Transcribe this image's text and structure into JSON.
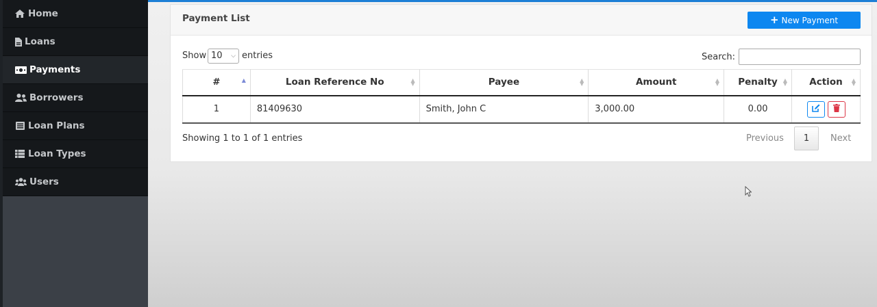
{
  "sidebar": {
    "items": [
      {
        "label": "Home",
        "icon": "home-icon"
      },
      {
        "label": "Loans",
        "icon": "file-icon"
      },
      {
        "label": "Payments",
        "icon": "money-bill-icon",
        "active": true
      },
      {
        "label": "Borrowers",
        "icon": "user-friends-icon"
      },
      {
        "label": "Loan Plans",
        "icon": "list-alt-icon"
      },
      {
        "label": "Loan Types",
        "icon": "th-list-icon"
      },
      {
        "label": "Users",
        "icon": "users-icon"
      }
    ]
  },
  "card": {
    "title": "Payment List",
    "new_button": "New Payment"
  },
  "controls": {
    "show_label": "Show",
    "page_length": "10",
    "entries_label": "entries",
    "search_label": "Search:",
    "search_value": ""
  },
  "table": {
    "columns": [
      "#",
      "Loan Reference No",
      "Payee",
      "Amount",
      "Penalty",
      "Action"
    ],
    "rows": [
      {
        "num": "1",
        "ref": "81409630",
        "payee": "Smith, John C",
        "amount": "3,000.00",
        "penalty": "0.00"
      }
    ]
  },
  "footer": {
    "info": "Showing 1 to 1 of 1 entries",
    "previous": "Previous",
    "page": "1",
    "next": "Next"
  },
  "colors": {
    "primary": "#0d87f0",
    "danger": "#dc3545",
    "sidebar_bg": "#15181b"
  }
}
